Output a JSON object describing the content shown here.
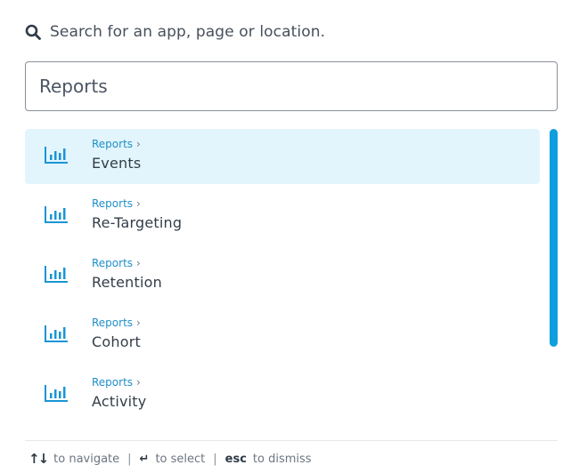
{
  "header": {
    "icon": "search-icon",
    "hint": "Search for an app, page or location."
  },
  "search": {
    "value": "Reports",
    "placeholder": ""
  },
  "results": [
    {
      "breadcrumb": "Reports",
      "title": "Events",
      "icon": "bar-chart-icon",
      "active": true
    },
    {
      "breadcrumb": "Reports",
      "title": "Re-Targeting",
      "icon": "bar-chart-icon",
      "active": false
    },
    {
      "breadcrumb": "Reports",
      "title": "Retention",
      "icon": "bar-chart-icon",
      "active": false
    },
    {
      "breadcrumb": "Reports",
      "title": "Cohort",
      "icon": "bar-chart-icon",
      "active": false
    },
    {
      "breadcrumb": "Reports",
      "title": "Activity",
      "icon": "bar-chart-icon",
      "active": false
    }
  ],
  "footer": {
    "navigate_keys": "↑↓",
    "navigate_label": "to navigate",
    "select_key": "↵",
    "select_label": "to select",
    "dismiss_key": "esc",
    "dismiss_label": "to dismiss"
  },
  "colors": {
    "accent": "#0f9ede",
    "active_row": "#e2f5fc",
    "breadcrumb": "#1e8fc9"
  }
}
